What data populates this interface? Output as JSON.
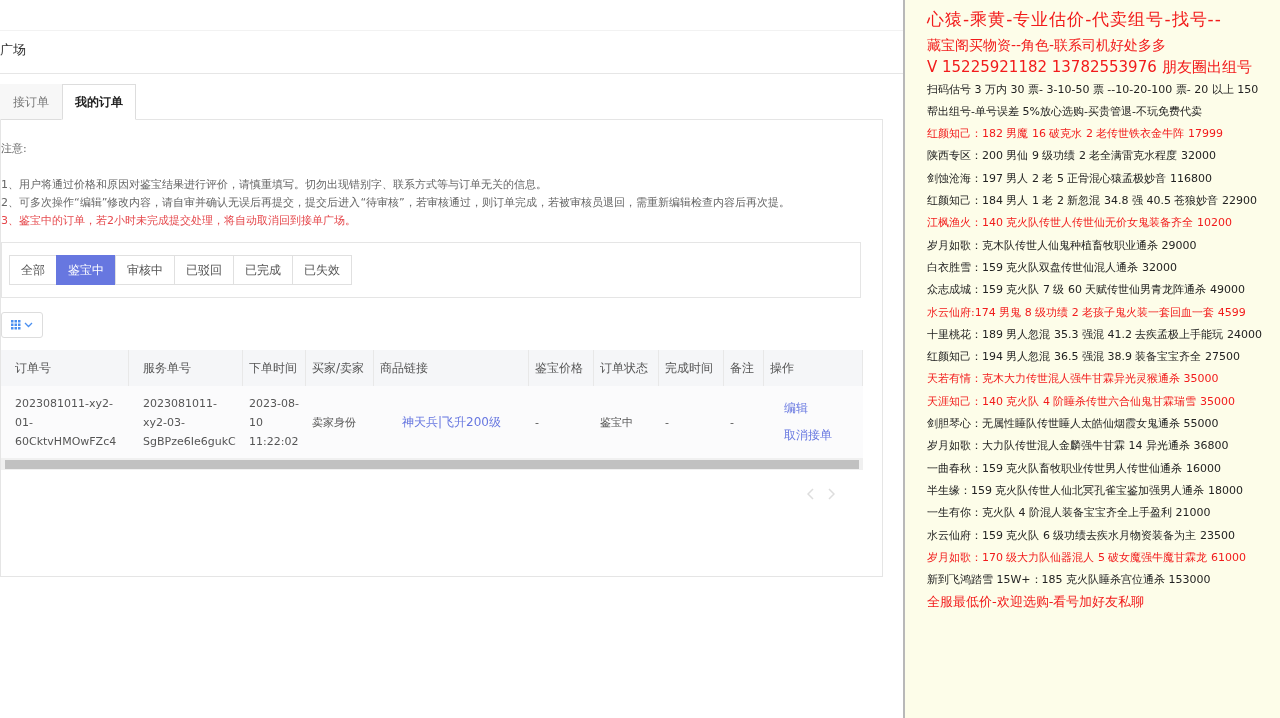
{
  "page": {
    "title": "广场"
  },
  "tabs": [
    {
      "label": "接订单",
      "selected": false
    },
    {
      "label": "我的订单",
      "selected": true
    }
  ],
  "notice": {
    "heading": "注意:",
    "items": [
      {
        "text": "1、用户将通过价格和原因对鉴宝结果进行评价，请慎重填写。切勿出现错别字、联系方式等与订单无关的信息。",
        "kind": "normal"
      },
      {
        "text": "2、可多次操作“编辑”修改内容，请自审并确认无误后再提交，提交后进入“待审核”，若审核通过，则订单完成，若被审核员退回，需重新编辑检查内容后再次提。",
        "kind": "normal"
      },
      {
        "text": "3、鉴宝中的订单，若2小时未完成提交处理，将自动取消回到接单广场。",
        "kind": "warning"
      }
    ]
  },
  "filters": [
    {
      "label": "全部",
      "selected": false
    },
    {
      "label": "鉴宝中",
      "selected": true
    },
    {
      "label": "审核中",
      "selected": false
    },
    {
      "label": "已驳回",
      "selected": false
    },
    {
      "label": "已完成",
      "selected": false
    },
    {
      "label": "已失效",
      "selected": false
    }
  ],
  "table": {
    "columns": [
      "订单号",
      "服务单号",
      "下单时间",
      "买家/卖家",
      "商品链接",
      "鉴宝价格",
      "订单状态",
      "完成时间",
      "备注",
      "操作"
    ],
    "rows": [
      {
        "order_no": "2023081011-xy2-01-60CktvHMOwFZc4",
        "service_no": "2023081011-xy2-03-SgBPze6Ie6gukC",
        "time": "2023-08-10 11:22:02",
        "role": "卖家身份",
        "link": "神天兵|飞升200级",
        "price": "-",
        "status": "鉴宝中",
        "done_time": "-",
        "remark": "-",
        "actions": [
          "编辑",
          "取消接单"
        ]
      }
    ]
  },
  "document": {
    "lines": [
      {
        "text": "心猿-乘黄-专业估价-代卖组号-找号--",
        "kind": "title"
      },
      {
        "text": "藏宝阁买物资--角色-联系司机好处多多",
        "kind": "headline"
      },
      {
        "text": "V 15225921182    13782553976 朋友圈出组号",
        "kind": "headline"
      },
      {
        "text": "扫码估号 3 万内 30 票- 3-10-50 票  --10-20-100 票- 20 以上 150",
        "kind": "plain"
      },
      {
        "text": "帮出组号-单号误差 5%放心选购-买贵管退-不玩免费代卖",
        "kind": "plain"
      },
      {
        "text": "红颜知己：182 男魔 16 破克水 2 老传世铁衣金牛阵 17999",
        "kind": "hot"
      },
      {
        "text": "陕西专区：200 男仙 9 级功绩 2 老全满雷克水程度 32000",
        "kind": "plain"
      },
      {
        "text": "剑蚀沧海：197 男人 2 老 5 正骨混心猿孟极妙音 116800",
        "kind": "plain"
      },
      {
        "text": "红颜知己：184 男人 1 老 2 新忽混 34.8 强 40.5 苍狼妙音 22900",
        "kind": "plain"
      },
      {
        "text": "江枫渔火：140 克火队传世人传世仙无价女鬼装备齐全 10200",
        "kind": "hot"
      },
      {
        "text": "岁月如歌：克木队传世人仙鬼种植畜牧职业通杀 29000",
        "kind": "plain"
      },
      {
        "text": "白衣胜雪：159 克火队双盘传世仙混人通杀 32000",
        "kind": "plain"
      },
      {
        "text": "众志成城：159 克火队 7 级 60 天赋传世仙男青龙阵通杀 49000",
        "kind": "plain"
      },
      {
        "text": "水云仙府:174 男鬼 8 级功绩 2 老孩子鬼火装一套回血一套 4599",
        "kind": "hot"
      },
      {
        "text": "十里桃花：189 男人忽混 35.3 强混 41.2 去疾孟极上手能玩 24000",
        "kind": "plain"
      },
      {
        "text": "红颜知己：194 男人忽混 36.5 强混 38.9 装备宝宝齐全 27500",
        "kind": "plain"
      },
      {
        "text": "天若有情：克木大力传世混人强牛甘霖异光灵猴通杀 35000",
        "kind": "hot"
      },
      {
        "text": "天涯知己：140 克火队 4 阶睡杀传世六合仙鬼甘霖瑞雪 35000",
        "kind": "hot"
      },
      {
        "text": "剑胆琴心：无属性睡队传世睡人太皓仙烟霞女鬼通杀 55000",
        "kind": "plain"
      },
      {
        "text": "岁月如歌：大力队传世混人金麟强牛甘霖 14 异光通杀 36800",
        "kind": "plain"
      },
      {
        "text": "一曲春秋：159 克火队畜牧职业传世男人传世仙通杀 16000",
        "kind": "plain"
      },
      {
        "text": "半生缘：159 克火队传世人仙北冥孔雀宝鉴加强男人通杀 18000",
        "kind": "plain"
      },
      {
        "text": "一生有你：克火队 4 阶混人装备宝宝齐全上手盈利 21000",
        "kind": "plain"
      },
      {
        "text": "水云仙府：159 克火队 6 级功绩去疾水月物资装备为主 23500",
        "kind": "plain"
      },
      {
        "text": "岁月如歌：170 级大力队仙器混人 5 破女魔强牛魔甘霖龙 61000",
        "kind": "hot"
      },
      {
        "text": "新到飞鸿踏雪 15W+：185 克火队睡杀宫位通杀 153000",
        "kind": "plain"
      },
      {
        "text": "全服最低价-欢迎选购-看号加好友私聊",
        "kind": "footer"
      }
    ]
  }
}
